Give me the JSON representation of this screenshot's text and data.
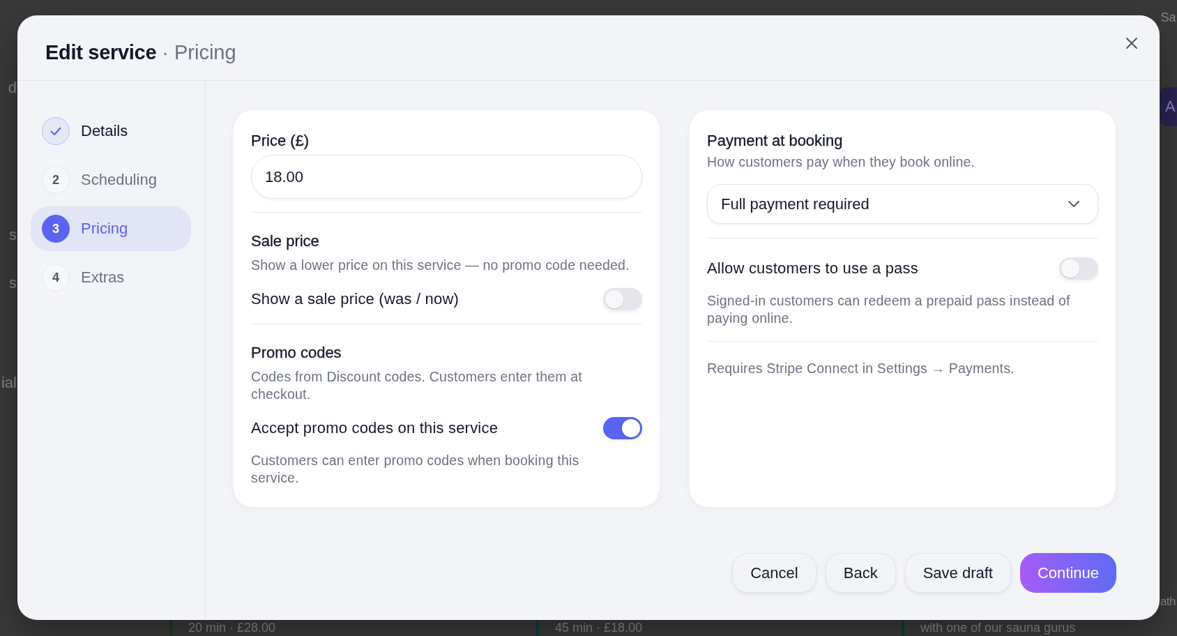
{
  "background_page": {
    "left_edge_texts": [
      "d",
      "s",
      "s",
      "ial"
    ],
    "top_right_text": "Sa",
    "right_edge_button": {
      "label": "A"
    },
    "right_edge_text": "ath",
    "service_cards": [
      {
        "text": "20 min · £28.00",
        "color": "#173f1e"
      },
      {
        "text": "45 min · £18.00",
        "color": "#0e3b40"
      },
      {
        "text": "with one of our sauna gurus",
        "color": "#0d3f32"
      }
    ]
  },
  "dialog": {
    "title": "Edit service",
    "subtitle": "· Pricing",
    "steps": [
      {
        "label": "Details",
        "completed": true,
        "selected": false
      },
      {
        "number": "2",
        "label": "Scheduling",
        "completed": false,
        "selected": false
      },
      {
        "number": "3",
        "label": "Pricing",
        "completed": false,
        "selected": true
      },
      {
        "number": "4",
        "label": "Extras",
        "completed": false,
        "selected": false
      }
    ],
    "pricing_card": {
      "price_field": {
        "label": "Price (£)",
        "value": "18.00"
      },
      "sections": [
        {
          "title": "Sale price",
          "description": "Show a lower price on this service — no promo code needed.",
          "toggle": {
            "label": "Show a sale price (was / now)",
            "on": false
          }
        },
        {
          "title": "Promo codes",
          "description": "Codes from Discount codes. Customers enter them at checkout.",
          "toggle": {
            "label": "Accept promo codes on this service",
            "on": true
          },
          "note": "Customers can enter promo codes when booking this service."
        }
      ]
    },
    "payment_card": {
      "title": "Payment at booking",
      "description": "How customers pay when they book online.",
      "select": {
        "value": "Full payment required"
      },
      "pass_toggle": {
        "label": "Allow customers to use a pass",
        "on": false,
        "description": "Signed-in customers can redeem a prepaid pass instead of paying online."
      },
      "footnote": "Requires Stripe Connect in Settings → Payments."
    },
    "buttons": [
      {
        "label": "Cancel",
        "kind": "secondary"
      },
      {
        "label": "Back",
        "kind": "secondary"
      },
      {
        "label": "Save draft",
        "kind": "secondary"
      },
      {
        "label": "Continue",
        "kind": "primary"
      }
    ]
  }
}
